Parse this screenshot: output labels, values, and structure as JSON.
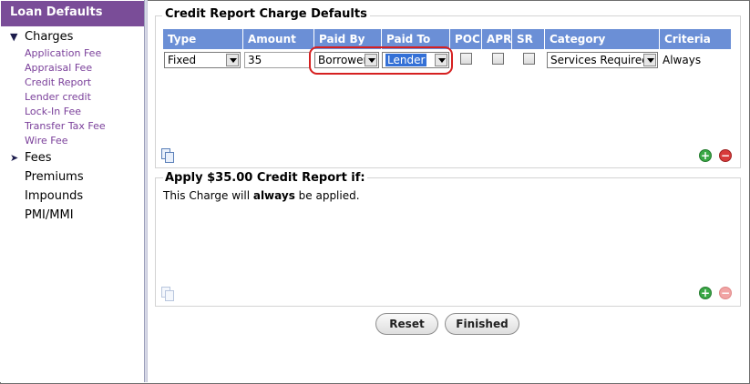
{
  "sidebar": {
    "title": "Loan Defaults",
    "groups": [
      {
        "label": "Charges",
        "expanded": true,
        "items": [
          "Application Fee",
          "Appraisal Fee",
          "Credit Report",
          "Lender credit",
          "Lock-In Fee",
          "Transfer Tax Fee",
          "Wire Fee"
        ]
      },
      {
        "label": "Fees",
        "expanded": false
      },
      {
        "label": "Premiums"
      },
      {
        "label": "Impounds"
      },
      {
        "label": "PMI/MMI"
      }
    ]
  },
  "charge_defaults": {
    "title": "Credit Report Charge Defaults",
    "columns": [
      "Type",
      "Amount",
      "Paid By",
      "Paid To",
      "POC",
      "APR",
      "SR",
      "Category",
      "Criteria"
    ],
    "row": {
      "type": "Fixed",
      "amount": "35",
      "paid_by": "Borrower",
      "paid_to": "Lender",
      "poc": false,
      "apr": false,
      "sr": false,
      "category": "Services Required",
      "criteria": "Always"
    }
  },
  "apply": {
    "heading": "Apply $35.00 Credit Report if:",
    "text_before": "This Charge will ",
    "text_bold": "always",
    "text_after": " be applied."
  },
  "buttons": {
    "reset": "Reset",
    "finished": "Finished"
  },
  "colors": {
    "sidebar_header": "#7a4d98",
    "grid_header": "#6b8fd6",
    "link": "#7a3f9a",
    "highlight": "#d62020"
  }
}
